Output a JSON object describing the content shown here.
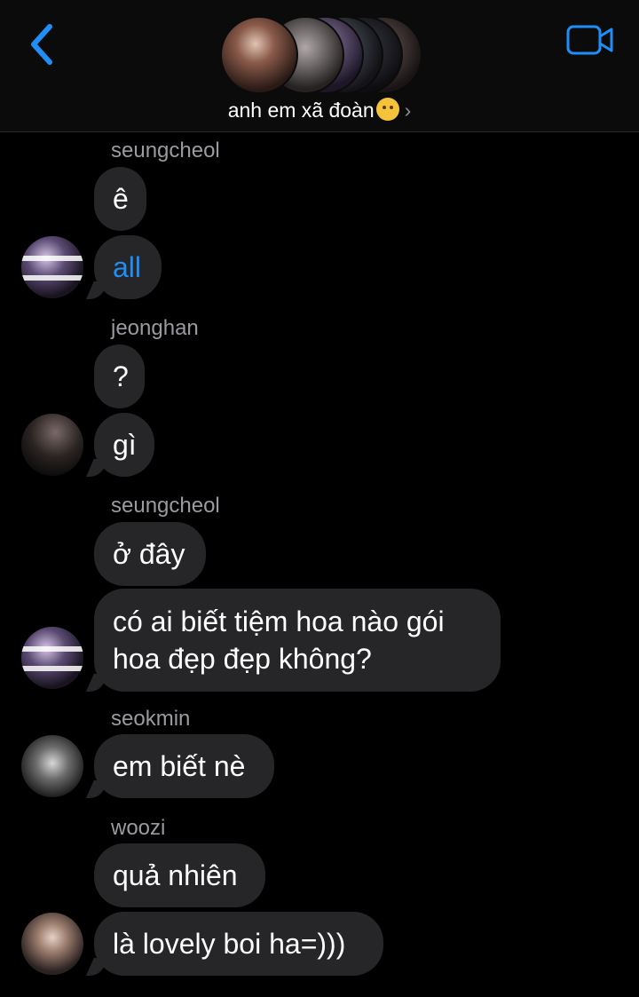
{
  "header": {
    "group_name": "anh em xã đoàn",
    "chevron": "›",
    "back_icon": "chevron-left-icon",
    "video_icon": "video-camera-icon",
    "accent_color": "#1f8ff7"
  },
  "messages": [
    {
      "sender": "seungcheol",
      "bubbles": [
        "ê",
        "all"
      ],
      "mention_index": 1
    },
    {
      "sender": "jeonghan",
      "bubbles": [
        "?",
        "gì"
      ]
    },
    {
      "sender": "seungcheol",
      "bubbles": [
        "ở đây",
        "có ai biết tiệm hoa nào gói",
        "hoa đẹp đẹp không?"
      ]
    },
    {
      "sender": "seokmin",
      "bubbles": [
        "em biết nè"
      ]
    },
    {
      "sender": "woozi",
      "bubbles": [
        "quả nhiên",
        "là lovely boi ha=)))"
      ]
    }
  ]
}
